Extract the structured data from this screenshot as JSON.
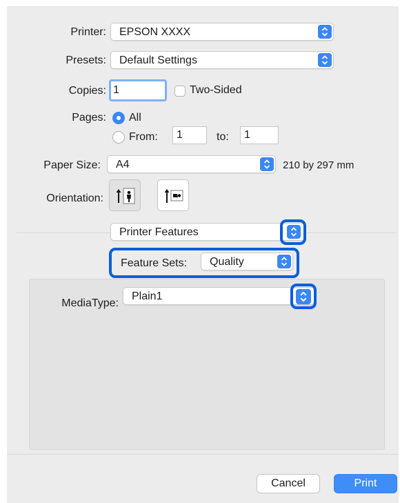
{
  "printer": {
    "label": "Printer:",
    "value": "EPSON XXXX"
  },
  "presets": {
    "label": "Presets:",
    "value": "Default Settings"
  },
  "copies": {
    "label": "Copies:",
    "value": "1",
    "two_sided_label": "Two-Sided",
    "two_sided_checked": false
  },
  "pages": {
    "label": "Pages:",
    "all_label": "All",
    "from_label": "From:",
    "from_value": "1",
    "to_label": "to:",
    "to_value": "1",
    "selected": "All"
  },
  "paper_size": {
    "label": "Paper Size:",
    "value": "A4",
    "dimensions": "210 by 297 mm"
  },
  "orientation": {
    "label": "Orientation:",
    "options": [
      "portrait",
      "landscape"
    ],
    "selected": "portrait"
  },
  "panel_menu": {
    "value": "Printer Features"
  },
  "feature_sets": {
    "label": "Feature Sets:",
    "value": "Quality"
  },
  "media_type": {
    "label": "MediaType:",
    "value": "Plain1"
  },
  "buttons": {
    "cancel": "Cancel",
    "print": "Print"
  },
  "colors": {
    "accent": "#3a87f5",
    "highlight": "#0b5ed7",
    "dialog_bg": "#ececec"
  }
}
